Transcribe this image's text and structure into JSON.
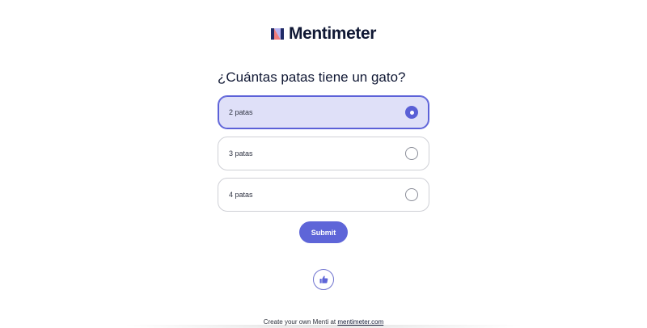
{
  "brand": {
    "name": "Mentimeter",
    "logo_icon": "mentimeter-logo-icon"
  },
  "question": "¿Cuántas patas tiene un gato?",
  "options": [
    {
      "label": "2 patas",
      "selected": true
    },
    {
      "label": "3 patas",
      "selected": false
    },
    {
      "label": "4 patas",
      "selected": false
    }
  ],
  "submit_label": "Submit",
  "reaction": {
    "icon": "thumbs-up-icon"
  },
  "footer": {
    "text": "Create your own Menti at",
    "link": "mentimeter.com"
  },
  "colors": {
    "accent": "#5e65d8",
    "selected_bg": "#dfe0f8",
    "selected_border": "#5c61d8",
    "logo_blue": "#1f2a66",
    "logo_pink": "#f27d7d",
    "logo_lavender": "#b7b4f2"
  }
}
